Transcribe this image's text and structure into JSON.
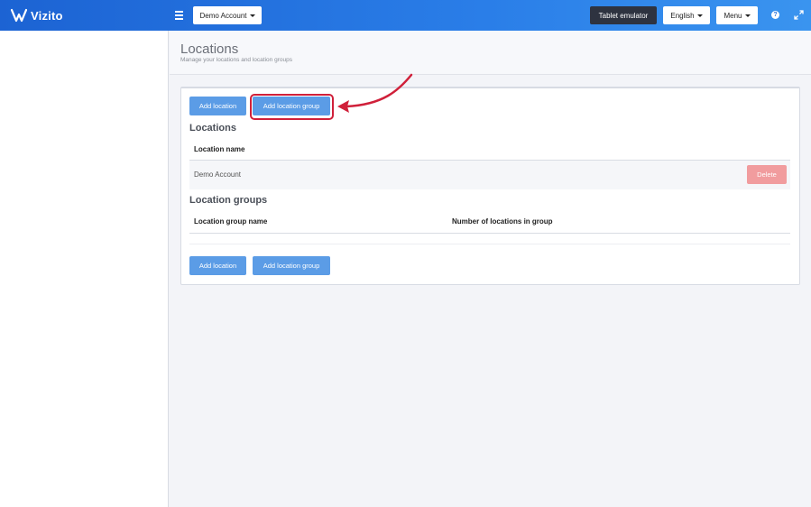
{
  "topbar": {
    "logo_text": "Vizito",
    "account_label": "Demo Account",
    "tablet_emulator_label": "Tablet emulator",
    "language_label": "English",
    "menu_label": "Menu",
    "help_glyph": "?",
    "accent_color": "#1f6fdc"
  },
  "page": {
    "title": "Locations",
    "subtitle": "Manage your locations and location groups"
  },
  "actions": {
    "add_location": "Add location",
    "add_location_group": "Add location group"
  },
  "locations": {
    "section_title": "Locations",
    "columns": [
      "Location name"
    ],
    "rows": [
      {
        "name": "Demo Account",
        "action": "Delete"
      }
    ]
  },
  "location_groups": {
    "section_title": "Location groups",
    "columns": [
      "Location group name",
      "Number of locations in group"
    ],
    "rows": []
  },
  "annotation": {
    "highlight_color": "#d0203a",
    "icons": [
      "hamburger-icon",
      "help-icon",
      "expand-icon",
      "vizito-logo-icon",
      "pointer-arrow"
    ]
  }
}
